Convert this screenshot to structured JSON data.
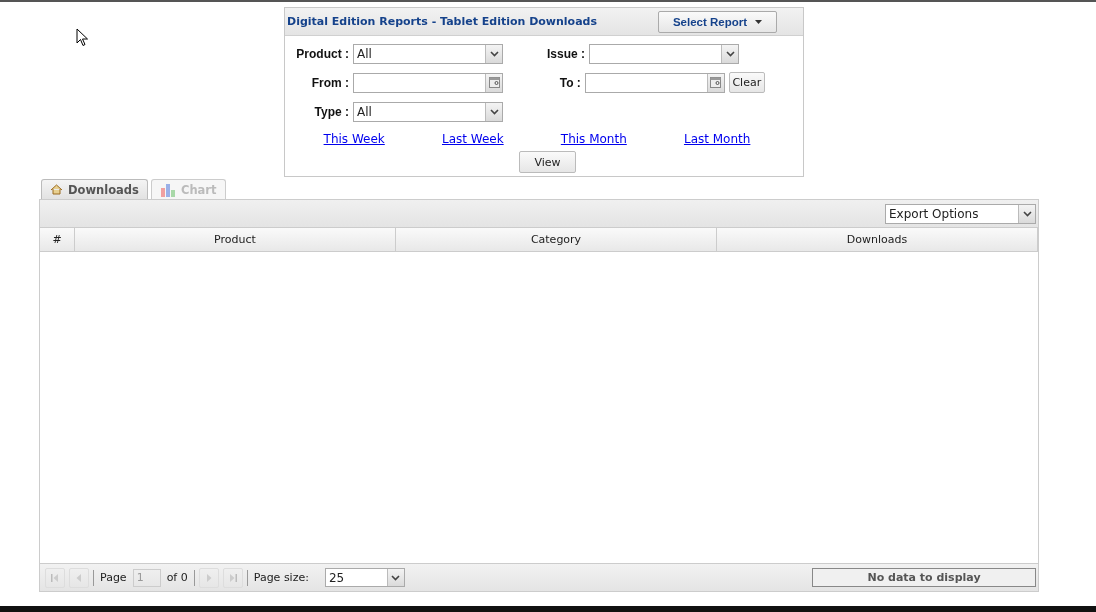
{
  "panel": {
    "title": "Digital Edition Reports - Tablet Edition Downloads",
    "select_report": "Select Report",
    "rows": [
      [
        {
          "kind": "select",
          "label": "Product :",
          "value": "All"
        },
        {
          "kind": "select",
          "label": "Issue :"
        }
      ],
      [
        {
          "kind": "date",
          "label": "From :"
        },
        {
          "kind": "date",
          "label": "To :",
          "button": "Clear"
        }
      ],
      [
        {
          "kind": "select",
          "label": "Type :",
          "value": "All"
        }
      ]
    ],
    "links": [
      "This Week",
      "Last Week",
      "This Month",
      "Last Month"
    ],
    "view": "View"
  },
  "tabs": [
    {
      "label": "Downloads",
      "selected": true,
      "kind": "home"
    },
    {
      "label": "Chart",
      "selected": false,
      "kind": "chart"
    }
  ],
  "export": {
    "value": "Export Options"
  },
  "table": {
    "columns": [
      "#",
      "Product",
      "Category",
      "Downloads"
    ]
  },
  "pager": {
    "page_label": "Page",
    "page": "1",
    "of": "of 0",
    "size_label": "Page size:",
    "size": "25",
    "status": "No data to display"
  }
}
